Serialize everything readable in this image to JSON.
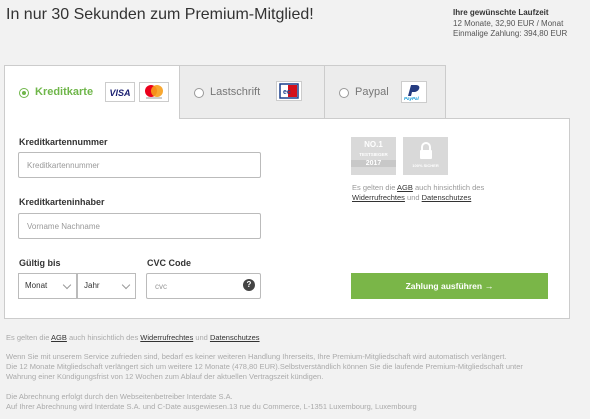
{
  "headline": "In nur 30 Sekunden zum Premium-Mitglied!",
  "summary": {
    "title": "Ihre gewünschte Laufzeit",
    "line1": "12 Monate, 32,90 EUR / Monat",
    "line2": "Einmalige Zahlung: 394,80 EUR"
  },
  "tabs": [
    {
      "label": "Kreditkarte",
      "selected": true
    },
    {
      "label": "Lastschrift",
      "selected": false
    },
    {
      "label": "Paypal",
      "selected": false
    }
  ],
  "logos": {
    "visa": "VISA",
    "ec": "ec",
    "paypal": "PayPal"
  },
  "form": {
    "cardnumber_label": "Kreditkartennummer",
    "cardnumber_placeholder": "Kreditkartennummer",
    "holder_label": "Kreditkarteninhaber",
    "holder_placeholder": "Vorname Nachname",
    "valid_label": "Gültig bis",
    "month_value": "Monat",
    "year_value": "Jahr",
    "cvc_label": "CVC Code",
    "cvc_placeholder": "cvc",
    "help": "?"
  },
  "badges": {
    "no1_line1": "NO.1",
    "no1_line2": "TESTSIEGER",
    "no1_line3": "2017",
    "secure": "100% SICHER"
  },
  "agb_right": {
    "pre": "Es gelten die",
    "agb": "AGB",
    "mid": "auch hinsichtlich des",
    "widerruf": "Widerrufrechtes",
    "und": "und",
    "datenschutz": "Datenschutzes"
  },
  "pay_button": "Zahlung ausführen",
  "footer": {
    "agb_pre": "Es gelten die",
    "agb": "AGB",
    "agb_mid": "auch hinsichtlich des",
    "widerruf": "Widerrufrechtes",
    "und": "und",
    "datenschutz": "Datenschutzes",
    "p1_l1": "Wenn Sie mit unserem Service zufrieden sind, bedarf es keiner weiteren Handlung Ihrerseits, Ihre Premium-Mitgliedschaft wird automatisch verlängert.",
    "p1_l2": "Die 12 Monate Mitgliedschaft verlängert sich um weitere 12 Monate (478,80 EUR).Selbstverständlich können Sie die laufende Premium-Mitgliedschaft unter",
    "p1_l3": "Wahrung einer Kündigungsfrist von 12 Wochen zum Ablauf der aktuellen Vertragszeit kündigen.",
    "p2_l1": "Die Abrechnung erfolgt durch den Webseitenbetreiber Interdate S.A.",
    "p2_l2": "Auf Ihrer Abrechnung wird Interdate S.A. und C-Date ausgewiesen.13 rue du Commerce, L-1351 Luxembourg, Luxembourg"
  },
  "colors": {
    "accent": "#7ab648",
    "radio_active": "#6fb64a"
  }
}
